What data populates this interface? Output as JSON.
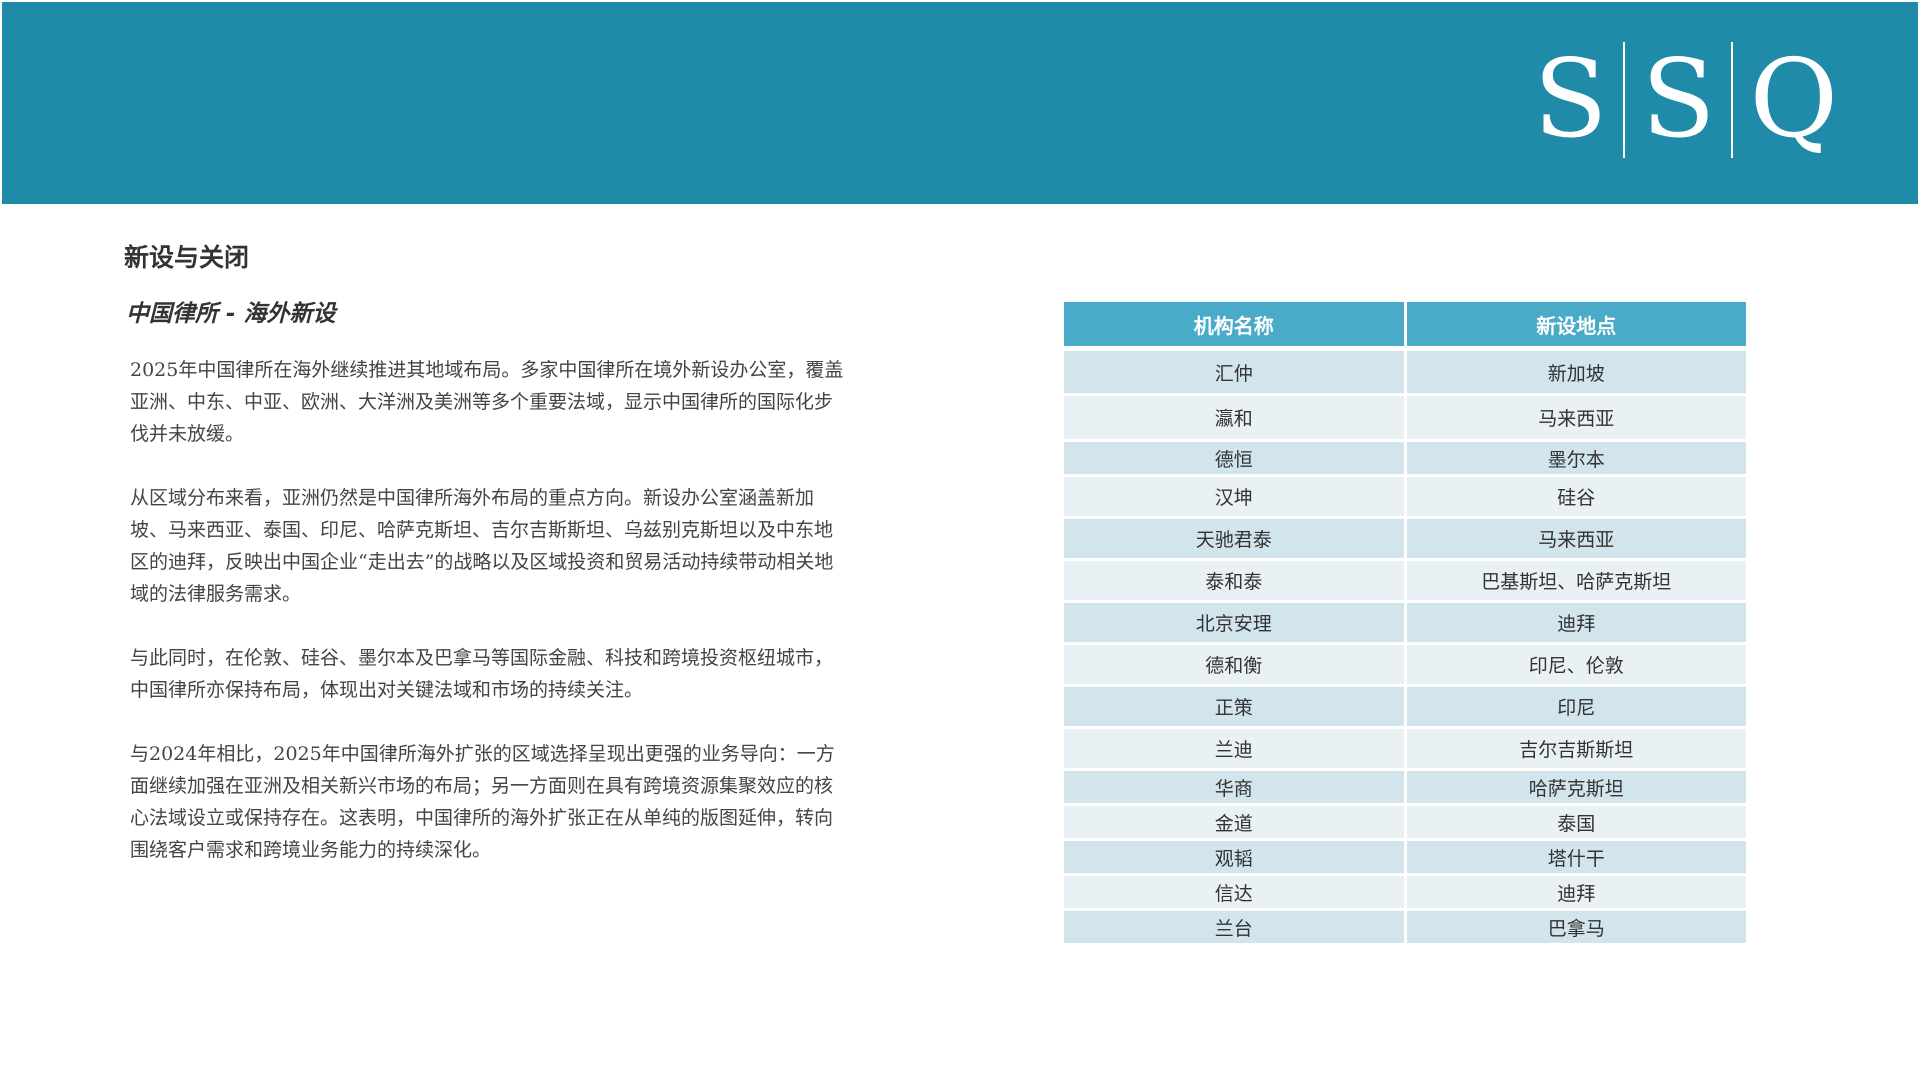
{
  "logo": {
    "letters": [
      "S",
      "S",
      "Q"
    ]
  },
  "section_title": "新设与关闭",
  "subtitle": "中国律所 - 海外新设",
  "paragraphs": [
    "2025年中国律所在海外继续推进其地域布局。多家中国律所在境外新设办公室，覆盖亚洲、中东、中亚、欧洲、大洋洲及美洲等多个重要法域，显示中国律所的国际化步伐并未放缓。",
    "从区域分布来看，亚洲仍然是中国律所海外布局的重点方向。新设办公室涵盖新加坡、马来西亚、泰国、印尼、哈萨克斯坦、吉尔吉斯斯坦、乌兹别克斯坦以及中东地区的迪拜，反映出中国企业“走出去”的战略以及区域投资和贸易活动持续带动相关地域的法律服务需求。",
    "与此同时，在伦敦、硅谷、墨尔本及巴拿马等国际金融、科技和跨境投资枢纽城市，中国律所亦保持布局，体现出对关键法域和市场的持续关注。",
    "与2024年相比，2025年中国律所海外扩张的区域选择呈现出更强的业务导向：一方面继续加强在亚洲及相关新兴市场的布局；另一方面则在具有跨境资源集聚效应的核心法域设立或保持存在。这表明，中国律所的海外扩张正在从单纯的版图延伸，转向围绕客户需求和跨境业务能力的持续深化。"
  ],
  "table": {
    "headers": [
      "机构名称",
      "新设地点"
    ],
    "rows": [
      [
        "汇仲",
        "新加坡"
      ],
      [
        "瀛和",
        "马来西亚"
      ],
      [
        "德恒",
        "墨尔本"
      ],
      [
        "汉坤",
        "硅谷"
      ],
      [
        "天驰君泰",
        "马来西亚"
      ],
      [
        "泰和泰",
        "巴基斯坦、哈萨克斯坦"
      ],
      [
        "北京安理",
        "迪拜"
      ],
      [
        "德和衡",
        "印尼、伦敦"
      ],
      [
        "正策",
        "印尼"
      ],
      [
        "兰迪",
        "吉尔吉斯斯坦"
      ],
      [
        "华商",
        "哈萨克斯坦"
      ],
      [
        "金道",
        "泰国"
      ],
      [
        "观韬",
        "塔什干"
      ],
      [
        "信达",
        "迪拜"
      ],
      [
        "兰台",
        "巴拿马"
      ]
    ]
  },
  "colors": {
    "header_band": "#1f8ba8",
    "table_header": "#4aabc8",
    "row_odd": "#d2e4ec",
    "row_even": "#e9f1f5"
  }
}
